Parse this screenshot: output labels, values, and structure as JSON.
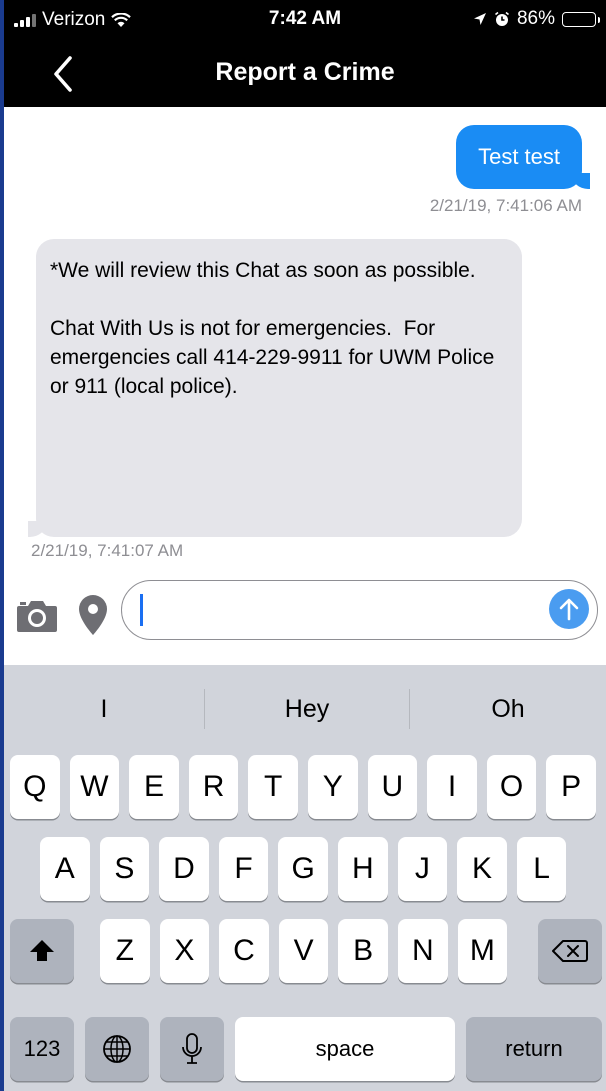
{
  "status_bar": {
    "carrier": "Verizon",
    "time": "7:42 AM",
    "battery": "86%",
    "battery_level": 0.86
  },
  "nav": {
    "title": "Report a Crime",
    "back_icon": "chevron-left-icon"
  },
  "messages": {
    "outgoing": {
      "text": "Test test",
      "timestamp": "2/21/19, 7:41:06 AM"
    },
    "incoming": {
      "text": "*We will review this Chat as soon as possible.\n\nChat With Us is not for emergencies.  For emergencies call 414-229-9911 for UWM Police or 911 (local police).",
      "timestamp": "2/21/19, 7:41:07 AM"
    }
  },
  "composer": {
    "value": "",
    "placeholder": "",
    "icons": [
      "camera-icon",
      "location-pin-icon",
      "send-arrow-icon"
    ]
  },
  "keyboard": {
    "suggestions": [
      "I",
      "Hey",
      "Oh"
    ],
    "row1": [
      "Q",
      "W",
      "E",
      "R",
      "T",
      "Y",
      "U",
      "I",
      "O",
      "P"
    ],
    "row2": [
      "A",
      "S",
      "D",
      "F",
      "G",
      "H",
      "J",
      "K",
      "L"
    ],
    "row3": [
      "Z",
      "X",
      "C",
      "V",
      "B",
      "N",
      "M"
    ],
    "numbers_label": "123",
    "space_label": "space",
    "return_label": "return"
  },
  "colors": {
    "outgoing_bubble": "#1a8cf4",
    "incoming_bubble": "#e5e5ea",
    "send_button": "#4a9cf0",
    "keyboard_bg": "#d1d4db"
  }
}
